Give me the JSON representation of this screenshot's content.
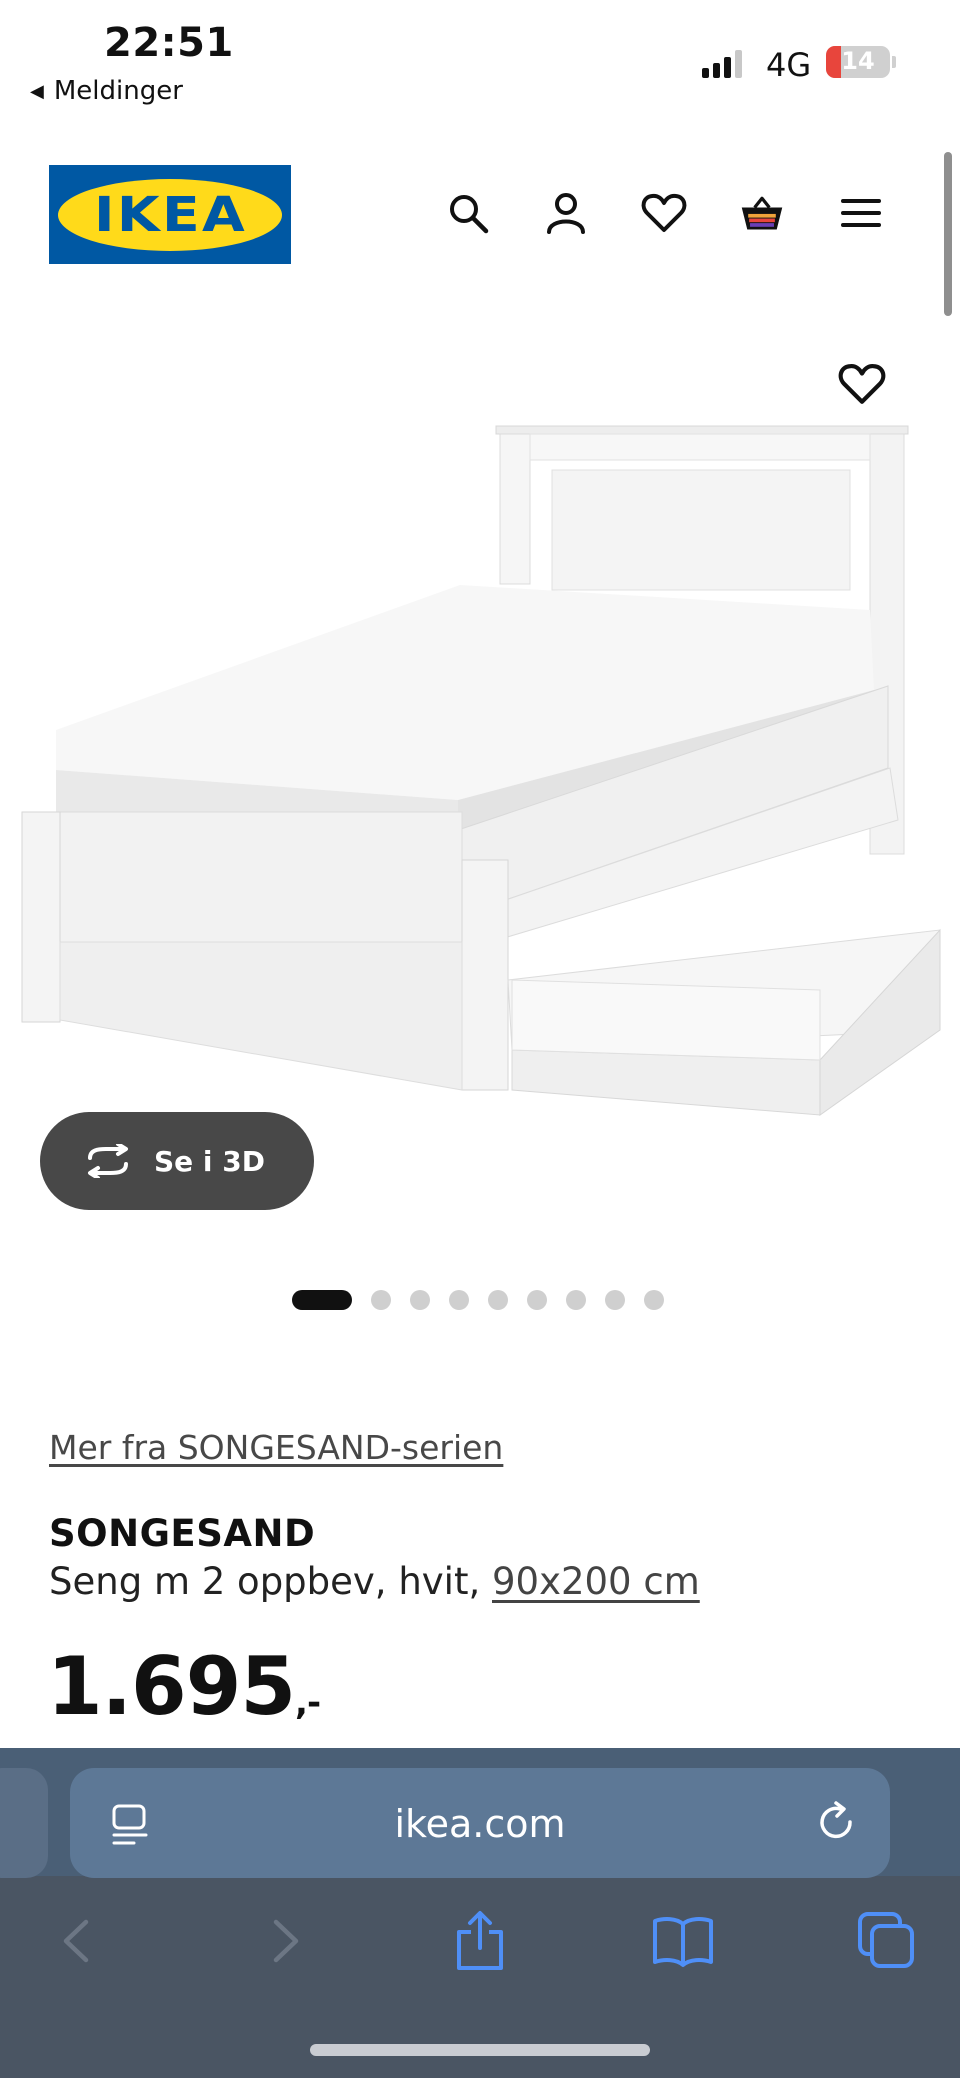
{
  "status": {
    "time": "22:51",
    "back_label": "Meldinger",
    "network": "4G",
    "battery": "14",
    "battery_level": 0.14
  },
  "header": {
    "logo_text": "IKEA"
  },
  "product": {
    "see_3d_label": "Se i 3D",
    "image_count": 9,
    "active_image": 1,
    "series_link": "Mer fra SONGESAND-serien",
    "name": "SONGESAND",
    "description": "Seng m 2 oppbev, hvit, ",
    "size_link": "90x200 cm",
    "price": "1.695",
    "price_suffix": ",-"
  },
  "browser": {
    "url": "ikea.com"
  },
  "colors": {
    "ikea_blue": "#0058a3",
    "ikea_yellow": "#ffda1a",
    "safari_accent": "#4f8ff7"
  }
}
